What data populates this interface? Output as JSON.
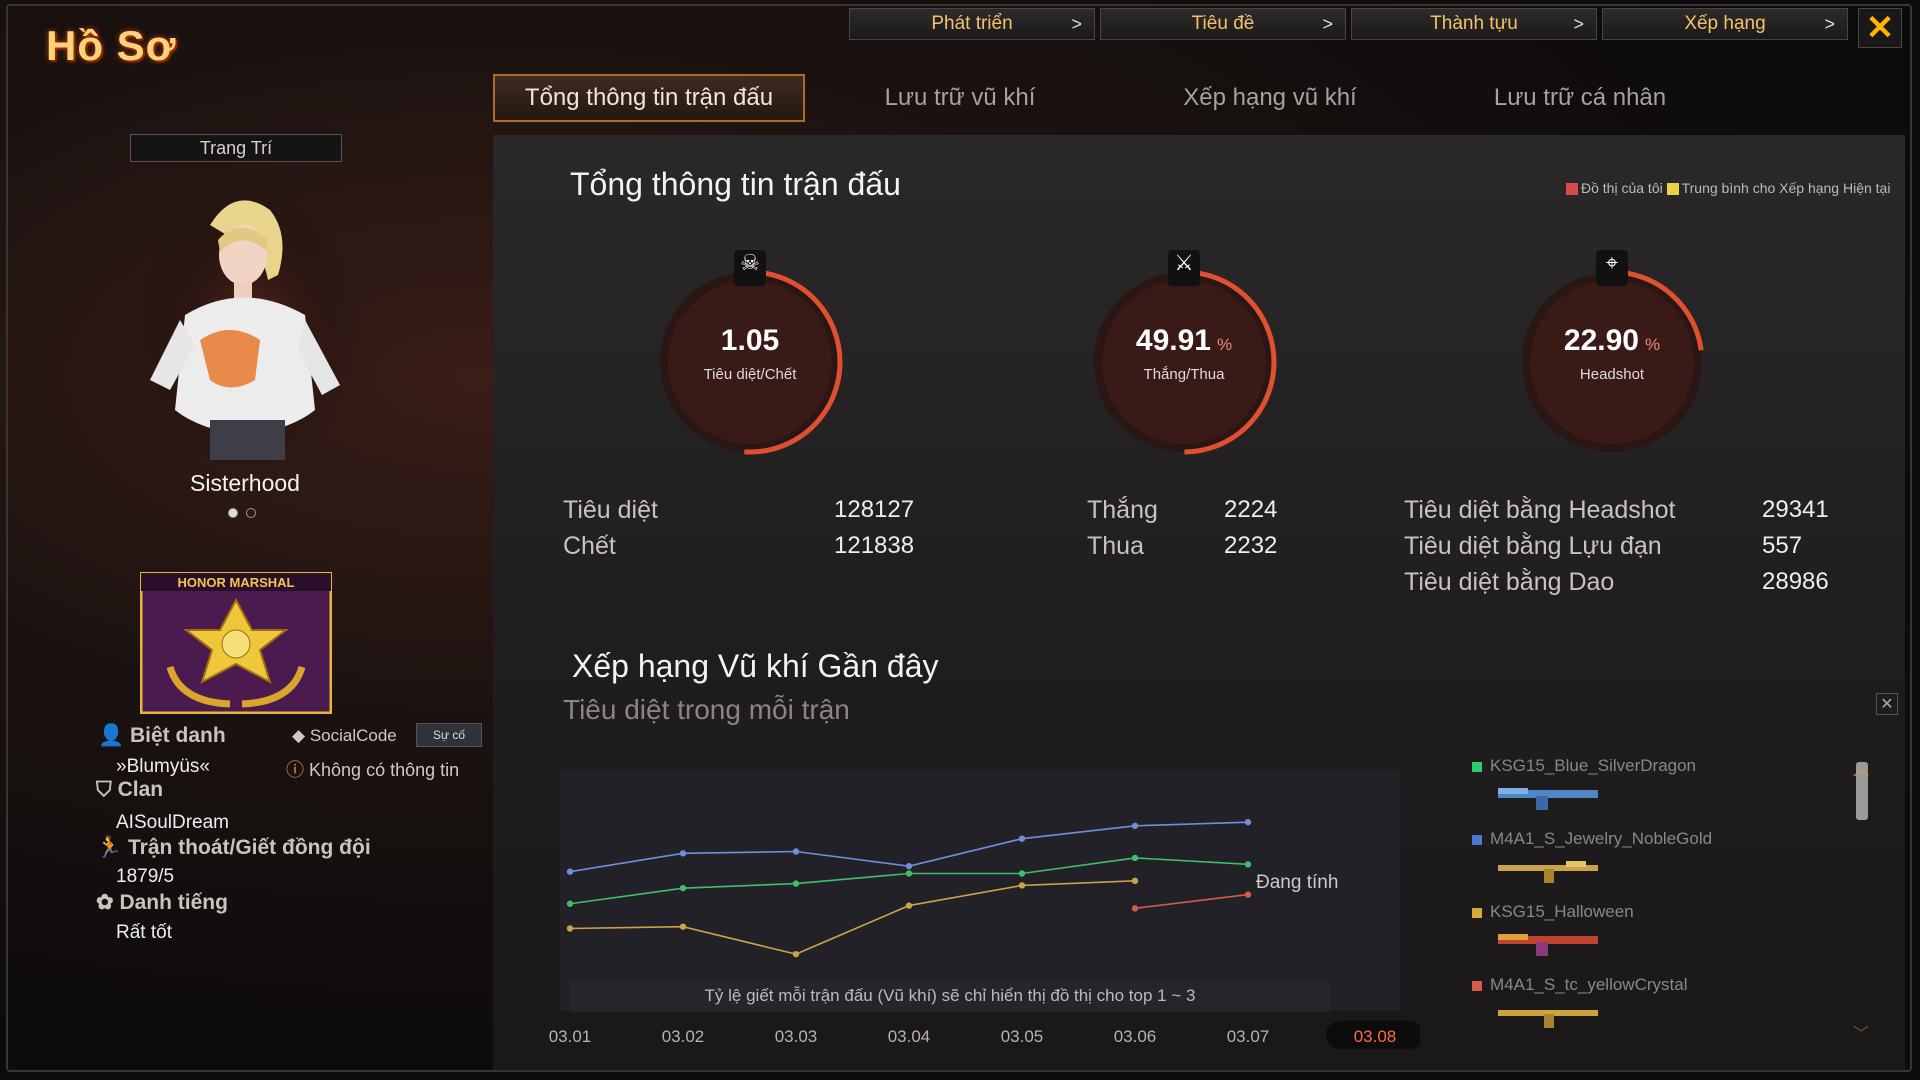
{
  "window": {
    "title": "Hồ Sơ",
    "close_icon": "close-icon"
  },
  "top_nav": [
    {
      "label": "Phát triển",
      "chevron": ">"
    },
    {
      "label": "Tiêu đề",
      "chevron": ">"
    },
    {
      "label": "Thành tựu",
      "chevron": ">"
    },
    {
      "label": "Xếp hạng",
      "chevron": ">"
    }
  ],
  "tabs": [
    {
      "label": "Tổng thông tin trận đấu",
      "active": true
    },
    {
      "label": "Lưu trữ vũ khí",
      "active": false
    },
    {
      "label": "Xếp hạng vũ khí",
      "active": false
    },
    {
      "label": "Lưu trữ cá nhân",
      "active": false
    }
  ],
  "sidebar": {
    "decor_button": "Trang Trí",
    "character_name": "Sisterhood",
    "rank_badge_text": "HONOR MARSHAL",
    "nickname_label": "Biệt danh",
    "nickname": "»Blumyüs«",
    "socialcode_label": "SocialCode",
    "socialcode_button": "Sự cố",
    "socialcode_value": "Không có thông tin",
    "clan_label": "Clan",
    "clan": "AISoulDream",
    "desert_label": "Trận thoát/Giết đồng đội",
    "desert_value": "1879/5",
    "reputation_label": "Danh tiếng",
    "reputation": "Rất tốt"
  },
  "main": {
    "section_title": "Tổng thông tin trận đấu",
    "legend": {
      "mine": "Đồ thị của tôi",
      "avg": "Trung bình cho Xếp hạng Hiện tại"
    },
    "gauges": [
      {
        "value": "1.05",
        "unit": "",
        "label": "Tiêu diệt/Chết",
        "fill": 0.51,
        "icon": "skull-icon"
      },
      {
        "value": "49.91",
        "unit": "%",
        "label": "Thắng/Thua",
        "fill": 0.4991,
        "icon": "crossed-swords-icon"
      },
      {
        "value": "22.90",
        "unit": "%",
        "label": "Headshot",
        "fill": 0.229,
        "icon": "headshot-icon"
      }
    ],
    "stats_kd": [
      {
        "label": "Tiêu diệt",
        "value": "128127"
      },
      {
        "label": "Chết",
        "value": "121838"
      }
    ],
    "stats_wl": [
      {
        "label": "Thắng",
        "value": "2224"
      },
      {
        "label": "Thua",
        "value": "2232"
      }
    ],
    "stats_hs": [
      {
        "label": "Tiêu diệt bằng Headshot",
        "value": "29341"
      },
      {
        "label": "Tiêu diệt bằng Lựu đạn",
        "value": "557"
      },
      {
        "label": "Tiêu diệt bằng Dao",
        "value": "28986"
      }
    ],
    "weapon_section_title": "Xếp hạng Vũ khí Gần đây",
    "chart_subtitle": "Tiêu diệt trong mỗi trận",
    "calculating": "Đang tính",
    "chart_note": "Tỷ lệ giết mỗi trận đấu (Vũ khí) sẽ chỉ hiển thị đồ thị cho top 1 ~ 3",
    "weapons": [
      {
        "name": "KSG15_Blue_SilverDragon",
        "color": "#2ecc71"
      },
      {
        "name": "M4A1_S_Jewelry_NobleGold",
        "color": "#4a7bd0"
      },
      {
        "name": "KSG15_Halloween",
        "color": "#d8a83a"
      },
      {
        "name": "M4A1_S_tc_yellowCrystal",
        "color": "#d45b4b"
      }
    ]
  },
  "chart_data": {
    "type": "line",
    "x": [
      "03.01",
      "03.02",
      "03.03",
      "03.04",
      "03.05",
      "03.06",
      "03.07",
      "03.08"
    ],
    "highlighted_x": "03.08",
    "series": [
      {
        "color": "#6f8fd8",
        "values": [
          14,
          16,
          16.2,
          14.6,
          17.6,
          19,
          19.4,
          null
        ]
      },
      {
        "color": "#3fbf6a",
        "values": [
          10.5,
          12.2,
          12.7,
          13.8,
          13.8,
          15.5,
          14.8,
          null
        ]
      },
      {
        "color": "#c9a24a",
        "values": [
          7.8,
          8,
          5,
          10.3,
          12.5,
          13,
          null,
          null
        ]
      },
      {
        "color": "#d45b4b",
        "values": [
          null,
          null,
          null,
          null,
          null,
          10,
          11.5,
          null
        ]
      }
    ],
    "ylim": [
      0,
      24
    ],
    "grid": false
  }
}
